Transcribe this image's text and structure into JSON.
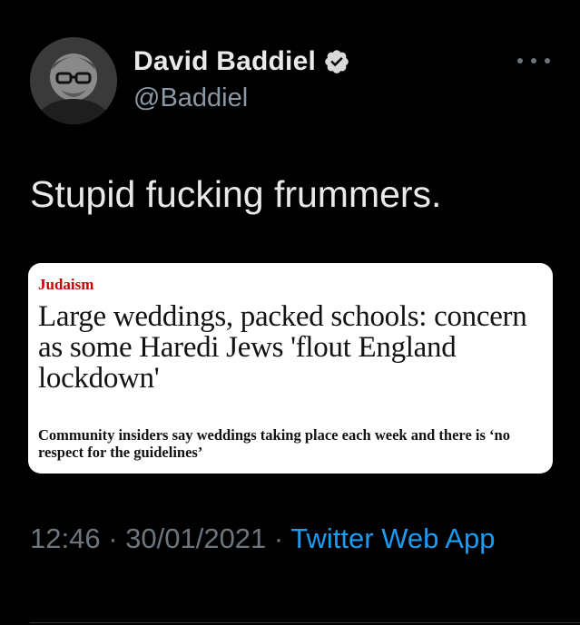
{
  "tweet": {
    "author": {
      "display_name": "David Baddiel",
      "handle": "@Baddiel",
      "verified": true
    },
    "text": "Stupid fucking frummers.",
    "card": {
      "kicker": "Judaism",
      "headline": "Large weddings, packed schools: concern as some Haredi Jews 'flout England lockdown'",
      "standfirst": "Community insiders say weddings taking place each week and there is ‘no respect for the guidelines’"
    },
    "meta": {
      "time": "12:46",
      "separator": " · ",
      "date": "30/01/2021",
      "source": "Twitter Web App"
    }
  },
  "icons": {
    "verified": "verified-badge-icon",
    "more": "more-options-icon"
  },
  "colors": {
    "background": "#000000",
    "link": "#1d9bf0",
    "secondary_text": "#6e767d",
    "kicker": "#c70000"
  }
}
